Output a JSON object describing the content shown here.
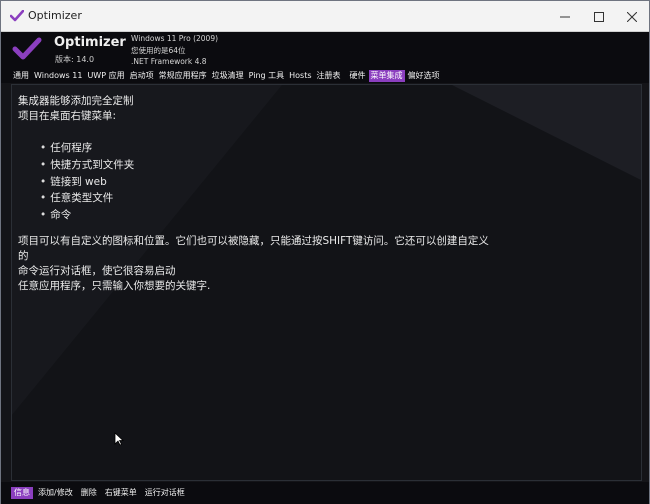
{
  "window": {
    "title": "Optimizer"
  },
  "header": {
    "app_name": "Optimizer",
    "version": "版本: 14.0",
    "os": "Windows 11 Pro (2009)",
    "arch": "您使用的是64位",
    "framework": ".NET Framework 4.8",
    "accent_color": "#8b3fbf"
  },
  "menu": {
    "items": [
      {
        "label": "通用",
        "active": false
      },
      {
        "label": "Windows 11",
        "active": false
      },
      {
        "label": "UWP 应用",
        "active": false
      },
      {
        "label": "启动项",
        "active": false
      },
      {
        "label": "常规应用程序",
        "active": false
      },
      {
        "label": "垃圾清理",
        "active": false
      },
      {
        "label": "Ping 工具",
        "active": false
      },
      {
        "label": "Hosts",
        "active": false
      },
      {
        "label": "注册表",
        "active": false
      },
      {
        "label": "硬件",
        "active": false
      },
      {
        "label": "菜单集成",
        "active": true
      },
      {
        "label": "偏好选项",
        "active": false
      }
    ]
  },
  "content": {
    "intro_line1": "集成器能够添加完全定制",
    "intro_line2": "项目在桌面右键菜单:",
    "bullets": [
      "任何程序",
      "快捷方式到文件夹",
      "链接到 web",
      "任意类型文件",
      "命令"
    ],
    "para_line1": "项目可以有自定义的图标和位置。它们也可以被隐藏，只能通过按SHIFT键访问。它还可以创建自定义",
    "para_line2": "的",
    "para_line3": "命令运行对话框，使它很容易启动",
    "para_line4": "任意应用程序，只需输入你想要的关键字."
  },
  "bottom_tabs": {
    "items": [
      {
        "label": "信息",
        "active": true
      },
      {
        "label": "添加/修改",
        "active": false
      },
      {
        "label": "删除",
        "active": false
      },
      {
        "label": "右键菜单",
        "active": false
      },
      {
        "label": "运行对话框",
        "active": false
      }
    ]
  },
  "icons": {
    "app": "check-logo-icon",
    "minimize": "minimize-icon",
    "maximize": "maximize-icon",
    "close": "close-icon",
    "cursor": "mouse-pointer-icon"
  }
}
